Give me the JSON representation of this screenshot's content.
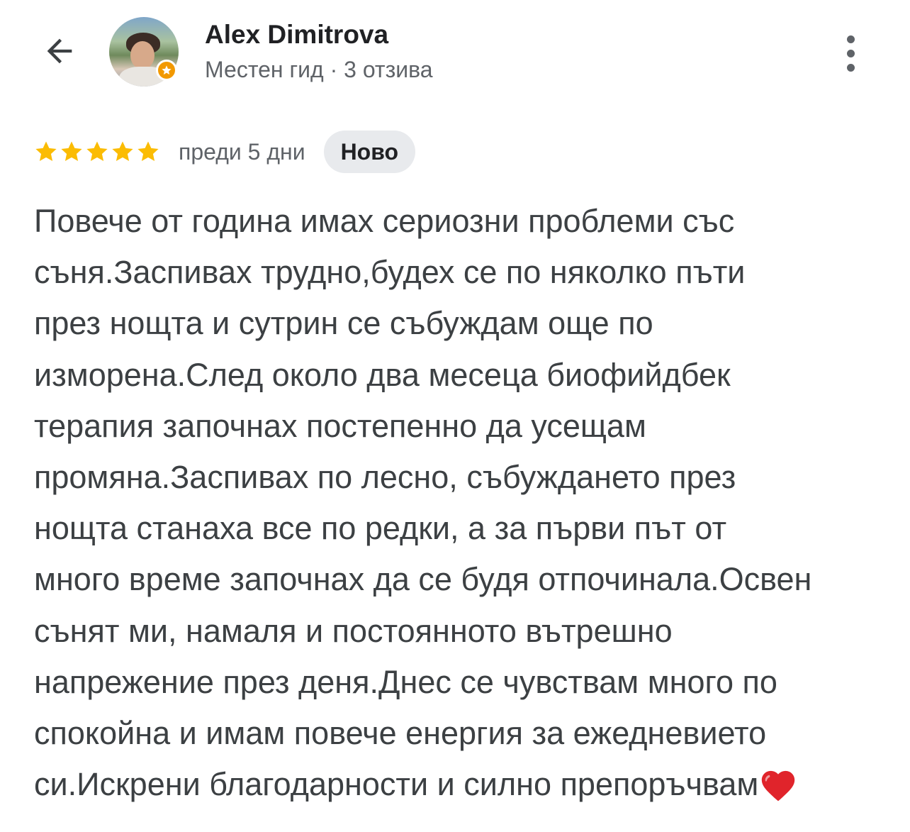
{
  "header": {
    "user_name": "Alex Dimitrova",
    "user_meta": "Местен гид · 3 отзива",
    "icons": {
      "back": "arrow-back-icon",
      "more": "more-vertical-icon",
      "badge": "local-guide-star-icon"
    }
  },
  "review": {
    "rating": 5,
    "rating_max": 5,
    "time": "преди 5 дни",
    "badge": "Ново",
    "text_lines": [
      "Повече от година имах сериозни проблеми със",
      "съня.Заспивах трудно,будех се по няколко пъти",
      "през нощта и сутрин се събуждам още по",
      "изморена.След около два месеца биофийдбек",
      "терапия започнах постепенно да усещам",
      "промяна.Заспивах по лесно, събуждането през",
      "нощта станаха все по редки, а за първи път от",
      "много време започнах да се будя отпочинала.Освен",
      "сънят ми, намаля и постоянното вътрешно",
      "напрежение през деня.Днес се чувствам много по",
      "спокойна и имам повече енергия за ежедневието",
      "си.Искрени благодарности и силно препоръчвам"
    ],
    "trailing_emoji": "heart-icon"
  },
  "colors": {
    "star": "#FBBC04",
    "text": "#3C4043",
    "meta": "#5F6368",
    "badge_bg": "#E8EAED",
    "heart": "#E0242B"
  }
}
